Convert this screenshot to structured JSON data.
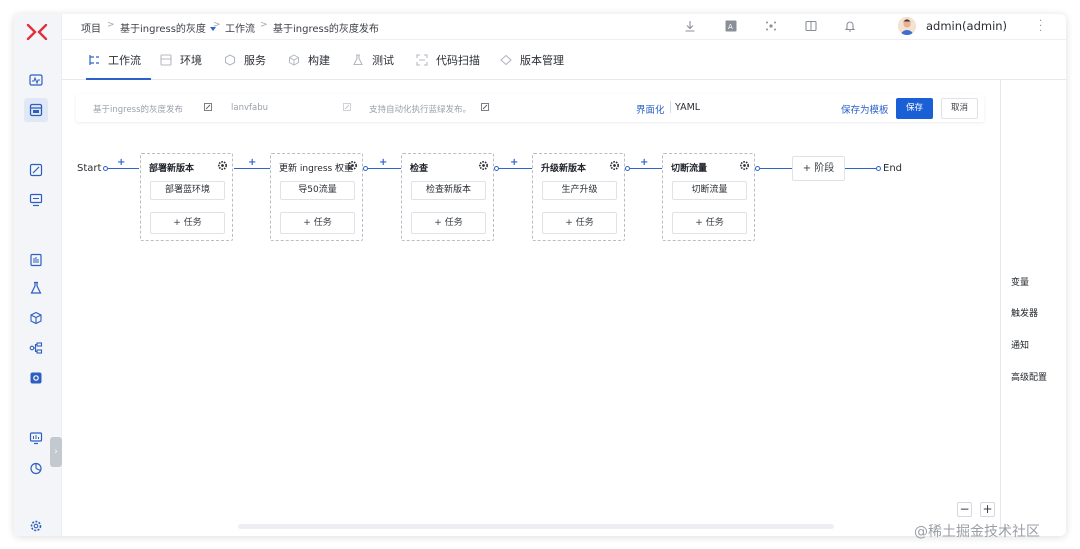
{
  "breadcrumb": [
    "项目",
    "基于ingress的灰度",
    "工作流",
    "基于ingress的灰度发布"
  ],
  "user": {
    "name": "admin(admin)"
  },
  "tabs": [
    {
      "label": "工作流",
      "icon": "workflow-icon",
      "active": true
    },
    {
      "label": "环境",
      "icon": "environment-icon"
    },
    {
      "label": "服务",
      "icon": "service-icon"
    },
    {
      "label": "构建",
      "icon": "build-icon"
    },
    {
      "label": "测试",
      "icon": "test-icon"
    },
    {
      "label": "代码扫描",
      "icon": "scan-icon"
    },
    {
      "label": "版本管理",
      "icon": "version-icon"
    }
  ],
  "info": {
    "name": "基于ingress的灰度发布",
    "key": "lanvfabu",
    "description": "支持自动化执行蓝绿发布。",
    "mode_ui": "界面化",
    "mode_yaml": "YAML",
    "save_template": "保存为模板",
    "save": "保存",
    "cancel": "取消"
  },
  "pipeline": {
    "start": "Start",
    "end": "End",
    "connector_plus": "+",
    "add_stage": "+ 阶段",
    "stages": [
      {
        "title": "部署新版本",
        "job": "部署蓝环境",
        "add_task": "+ 任务"
      },
      {
        "title": "更新 ingress 权重",
        "job": "导50流量",
        "add_task": "+ 任务"
      },
      {
        "title": "检查",
        "job": "检查新版本",
        "add_task": "+ 任务"
      },
      {
        "title": "升级新版本",
        "job": "生产升级",
        "add_task": "+ 任务"
      },
      {
        "title": "切断流量",
        "job": "切断流量",
        "add_task": "+ 任务"
      }
    ]
  },
  "right_panel": [
    "变量",
    "触发器",
    "通知",
    "高级配置"
  ],
  "zoom": {
    "minus": "−",
    "plus": "+"
  },
  "watermark": "@稀土掘金技术社区",
  "colors": {
    "accent": "#2b62c9",
    "primary_button": "#1b5fd6",
    "logo": "#e0303f"
  }
}
